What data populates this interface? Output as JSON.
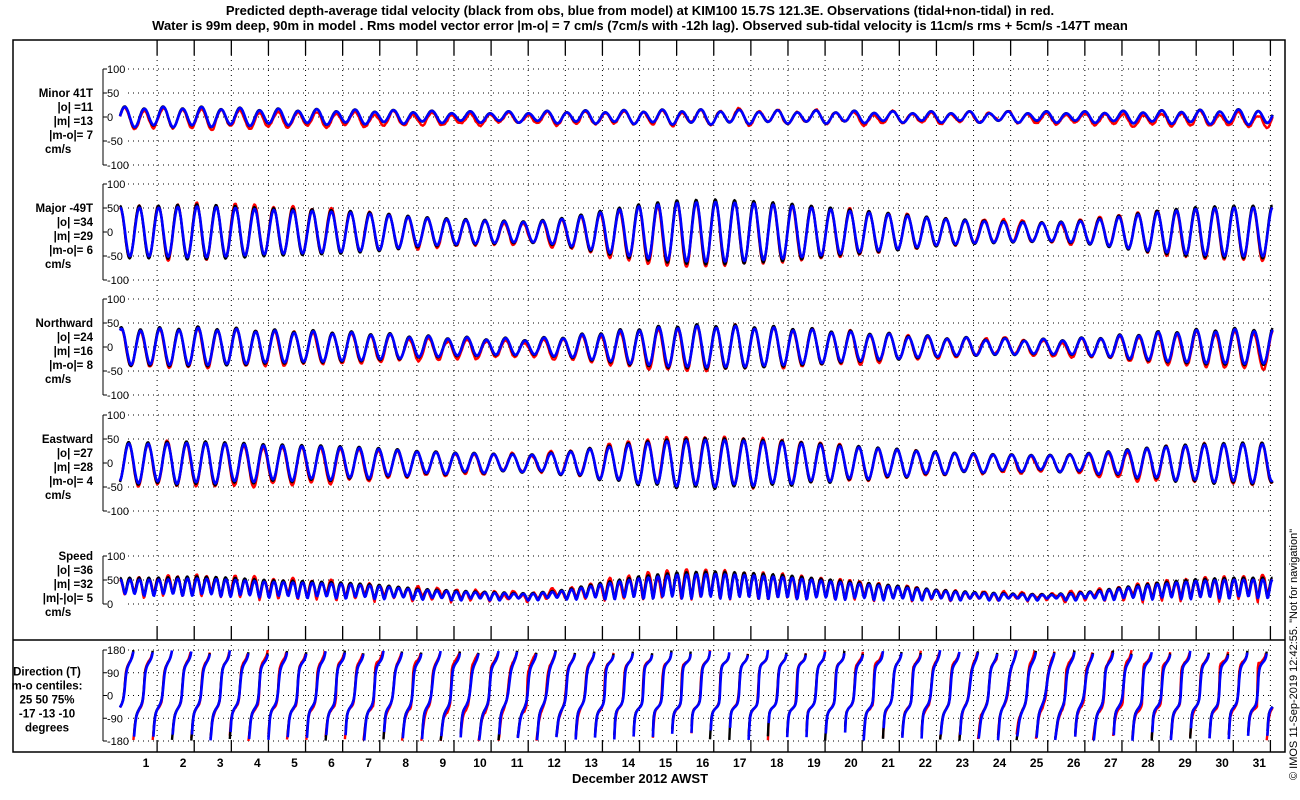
{
  "chart_data": {
    "type": "line",
    "title": [
      "Predicted depth-average tidal velocity (black from obs, blue from model) at KIM100 15.7S 121.3E. Observations (tidal+non-tidal) in red.",
      "Water is 99m deep, 90m in model . Rms model vector error |m-o| = 7 cm/s (7cm/s with -12h lag). Observed sub-tidal velocity is 11cm/s rms + 5cm/s -147T mean"
    ],
    "xlabel": "December 2012 AWST",
    "x_unit": "days",
    "xlim": [
      0,
      31.07
    ],
    "x_ticks": [
      "1",
      "2",
      "3",
      "4",
      "5",
      "6",
      "7",
      "8",
      "9",
      "10",
      "11",
      "12",
      "13",
      "14",
      "15",
      "16",
      "17",
      "18",
      "19",
      "20",
      "21",
      "22",
      "23",
      "24",
      "25",
      "26",
      "27",
      "28",
      "29",
      "30",
      "31"
    ],
    "grid": true,
    "series": [
      {
        "name": "tidal prediction from obs",
        "color": "#000000"
      },
      {
        "name": "tidal prediction from model",
        "color": "#0000ff"
      },
      {
        "name": "observations (tidal+non-tidal)",
        "color": "#ff0000"
      }
    ],
    "major_axis_deg": -49,
    "minor_axis_deg": 41,
    "semidiurnal_period_days": 0.5175,
    "major_amplitude_by_day_cm_s": [
      55,
      55,
      58,
      55,
      50,
      48,
      45,
      40,
      32,
      28,
      25,
      22,
      30,
      45,
      58,
      66,
      68,
      65,
      60,
      52,
      45,
      38,
      30,
      25,
      22,
      20,
      25,
      35,
      45,
      52,
      55,
      55
    ],
    "minor_amplitude_by_day_cm_s": [
      20,
      20,
      20,
      18,
      16,
      15,
      14,
      13,
      12,
      10,
      10,
      10,
      12,
      12,
      13,
      14,
      14,
      13,
      12,
      12,
      11,
      10,
      10,
      10,
      10,
      10,
      10,
      11,
      12,
      13,
      14,
      15
    ],
    "panels": [
      {
        "key": "minor",
        "label": [
          "Minor 41T",
          "|o| =11",
          "|m| =13",
          "|m-o|= 7",
          "cm/s"
        ],
        "ylim": [
          -100,
          100
        ],
        "yticks": [
          "100",
          "50",
          "0",
          "-50",
          "-100"
        ]
      },
      {
        "key": "major",
        "label": [
          "Major -49T",
          "|o| =34",
          "|m| =29",
          "|m-o|= 6",
          "cm/s"
        ],
        "ylim": [
          -100,
          100
        ],
        "yticks": [
          "100",
          "50",
          "0",
          "-50",
          "-100"
        ]
      },
      {
        "key": "north",
        "label": [
          "Northward",
          "|o| =24",
          "|m| =16",
          "|m-o|= 8",
          "cm/s"
        ],
        "ylim": [
          -100,
          100
        ],
        "yticks": [
          "100",
          "50",
          "0",
          "-50",
          "-100"
        ]
      },
      {
        "key": "east",
        "label": [
          "Eastward",
          "|o| =27",
          "|m| =28",
          "|m-o|= 4",
          "cm/s"
        ],
        "ylim": [
          -100,
          100
        ],
        "yticks": [
          "100",
          "50",
          "0",
          "-50",
          "-100"
        ]
      },
      {
        "key": "speed",
        "label": [
          "Speed",
          "|o| =36",
          "|m| =32",
          "|m|-|o|= 5",
          "cm/s"
        ],
        "ylim": [
          0,
          100
        ],
        "yticks": [
          "100",
          "50",
          "0"
        ]
      },
      {
        "key": "dir",
        "label": [
          "Direction (T)",
          "m-o centiles:",
          "25  50  75%",
          "-17 -13 -10",
          "degrees"
        ],
        "ylim": [
          -180,
          180
        ],
        "yticks": [
          "180",
          "90",
          "0",
          "-90",
          "-180"
        ]
      }
    ]
  },
  "footer": "© IMOS 11-Sep-2019 12:42:55. \"Not for navigation\""
}
